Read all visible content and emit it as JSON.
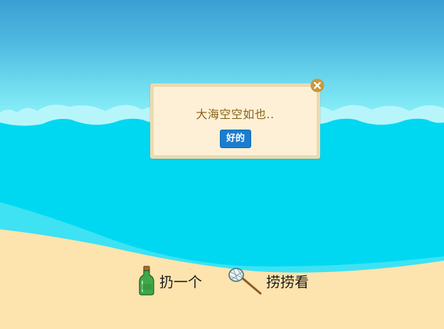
{
  "dialog": {
    "message": "大海空空如也..",
    "ok_label": "好的"
  },
  "actions": {
    "throw_label": "扔一个",
    "fish_label": "捞捞看"
  },
  "colors": {
    "sky_top": "#3b9fd3",
    "sea": "#00d8f2",
    "wave_foam": "#b6f6fb",
    "sand": "#fde3ad",
    "dialog_bg": "#fdf0d6",
    "dialog_border": "#ecd9b0",
    "message_text": "#8a6419",
    "button_blue": "#1b7dd0",
    "close_icon": "#c69a3d"
  },
  "icons": {
    "close": "close-icon",
    "bottle": "bottle-icon",
    "net": "net-icon"
  }
}
